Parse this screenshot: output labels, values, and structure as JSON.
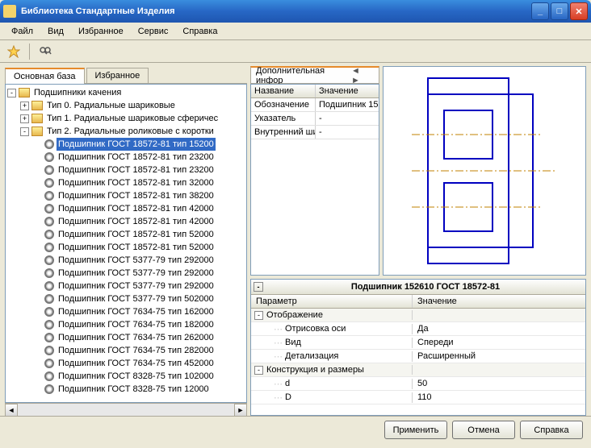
{
  "window": {
    "title": "Библиотека Стандартные Изделия"
  },
  "menu": {
    "file": "Файл",
    "view": "Вид",
    "fav": "Избранное",
    "service": "Сервис",
    "help": "Справка"
  },
  "left_tabs": {
    "main": "Основная база",
    "fav": "Избранное"
  },
  "tree": {
    "root": "Подшипники качения",
    "type0": "Тип 0. Радиальные шариковые",
    "type1": "Тип 1. Радиальные шариковые сферичес",
    "type2": "Тип 2. Радиальные роликовые с коротки",
    "items": [
      "Подшипник ГОСТ 18572-81 тип 15200",
      "Подшипник ГОСТ 18572-81 тип 23200",
      "Подшипник ГОСТ 18572-81 тип 23200",
      "Подшипник ГОСТ 18572-81 тип 32000",
      "Подшипник ГОСТ 18572-81 тип 38200",
      "Подшипник ГОСТ 18572-81 тип 42000",
      "Подшипник ГОСТ 18572-81 тип 42000",
      "Подшипник ГОСТ 18572-81 тип 52000",
      "Подшипник ГОСТ 18572-81 тип 52000",
      "Подшипник ГОСТ 5377-79 тип  292000",
      "Подшипник ГОСТ 5377-79 тип 292000",
      "Подшипник ГОСТ 5377-79 тип 292000",
      "Подшипник ГОСТ 5377-79 тип 502000",
      "Подшипник ГОСТ 7634-75 тип 162000",
      "Подшипник ГОСТ 7634-75 тип 182000",
      "Подшипник ГОСТ 7634-75 тип 262000",
      "Подшипник ГОСТ 7634-75 тип 282000",
      "Подшипник ГОСТ 7634-75 тип 452000",
      "Подшипник ГОСТ 8328-75 тип 102000",
      "Подшипник ГОСТ 8328-75 тип 12000"
    ],
    "selected": 0
  },
  "info": {
    "tab": "Дополнительная инфор",
    "hdr_name": "Название",
    "hdr_val": "Значение",
    "rows": [
      {
        "n": "Обозначение",
        "v": "Подшипник 15:"
      },
      {
        "n": "Указатель",
        "v": "-"
      },
      {
        "n": "Внутренний ши",
        "v": "-"
      }
    ]
  },
  "params": {
    "title": "Подшипник 152610 ГОСТ 18572-81",
    "hdr_param": "Параметр",
    "hdr_val": "Значение",
    "group1": "Отображение",
    "g1rows": [
      {
        "n": "Отрисовка оси",
        "v": "Да"
      },
      {
        "n": "Вид",
        "v": "Спереди"
      },
      {
        "n": "Детализация",
        "v": "Расширенный"
      }
    ],
    "group2": "Конструкция и размеры",
    "g2rows": [
      {
        "n": "d",
        "v": "50"
      },
      {
        "n": "D",
        "v": "110"
      }
    ]
  },
  "buttons": {
    "apply": "Применить",
    "cancel": "Отмена",
    "help": "Справка"
  }
}
